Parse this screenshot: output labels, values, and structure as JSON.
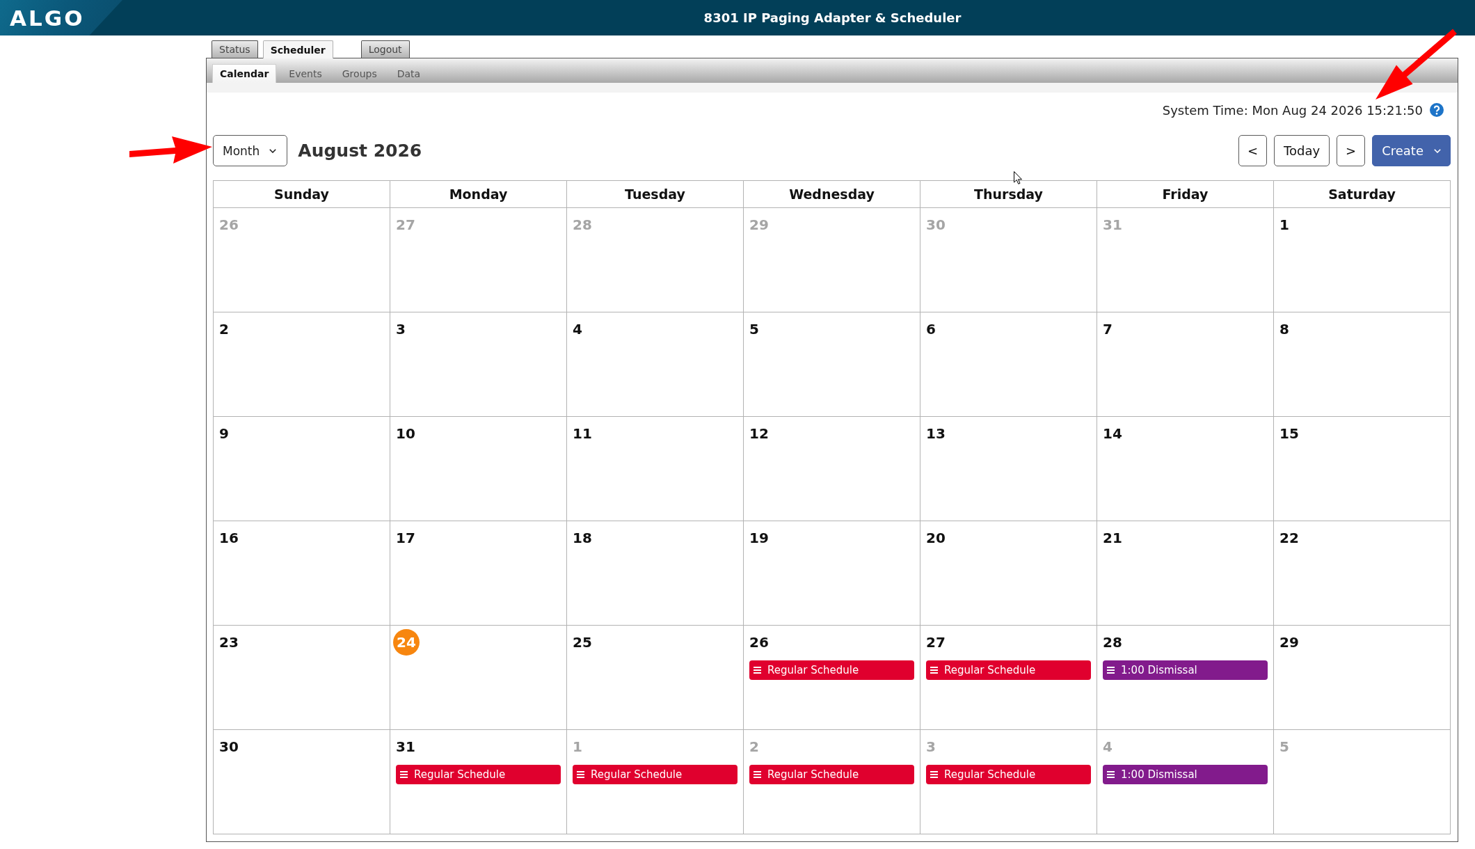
{
  "header": {
    "logo": "ALGO",
    "title": "8301 IP Paging Adapter & Scheduler"
  },
  "main_tabs": [
    {
      "label": "Status",
      "selected": false
    },
    {
      "label": "Scheduler",
      "selected": true
    }
  ],
  "logout": {
    "label": "Logout"
  },
  "sub_tabs": [
    {
      "label": "Calendar",
      "selected": true
    },
    {
      "label": "Events",
      "selected": false
    },
    {
      "label": "Groups",
      "selected": false
    },
    {
      "label": "Data",
      "selected": false
    }
  ],
  "system_time": "System Time: Mon Aug 24 2026 15:21:50",
  "toolbar": {
    "view_select": {
      "value": "Month"
    },
    "title": "August 2026",
    "buttons": [
      {
        "kind": "prev",
        "label": "<"
      },
      {
        "kind": "today",
        "label": "Today"
      },
      {
        "kind": "next",
        "label": ">"
      },
      {
        "kind": "create",
        "label": "Create"
      }
    ]
  },
  "calendar": {
    "columns": [
      "Sunday",
      "Monday",
      "Tuesday",
      "Wednesday",
      "Thursday",
      "Friday",
      "Saturday"
    ],
    "weeks": [
      {
        "days": [
          {
            "day": "26",
            "in_month": false,
            "today": false
          },
          {
            "day": "27",
            "in_month": false,
            "today": false
          },
          {
            "day": "28",
            "in_month": false,
            "today": false
          },
          {
            "day": "29",
            "in_month": false,
            "today": false
          },
          {
            "day": "30",
            "in_month": false,
            "today": false
          },
          {
            "day": "31",
            "in_month": false,
            "today": false
          },
          {
            "day": "1",
            "in_month": true,
            "today": false
          }
        ]
      },
      {
        "days": [
          {
            "day": "2",
            "in_month": true,
            "today": false
          },
          {
            "day": "3",
            "in_month": true,
            "today": false
          },
          {
            "day": "4",
            "in_month": true,
            "today": false
          },
          {
            "day": "5",
            "in_month": true,
            "today": false
          },
          {
            "day": "6",
            "in_month": true,
            "today": false
          },
          {
            "day": "7",
            "in_month": true,
            "today": false
          },
          {
            "day": "8",
            "in_month": true,
            "today": false
          }
        ]
      },
      {
        "days": [
          {
            "day": "9",
            "in_month": true,
            "today": false
          },
          {
            "day": "10",
            "in_month": true,
            "today": false
          },
          {
            "day": "11",
            "in_month": true,
            "today": false
          },
          {
            "day": "12",
            "in_month": true,
            "today": false
          },
          {
            "day": "13",
            "in_month": true,
            "today": false
          },
          {
            "day": "14",
            "in_month": true,
            "today": false
          },
          {
            "day": "15",
            "in_month": true,
            "today": false
          }
        ]
      },
      {
        "days": [
          {
            "day": "16",
            "in_month": true,
            "today": false
          },
          {
            "day": "17",
            "in_month": true,
            "today": false
          },
          {
            "day": "18",
            "in_month": true,
            "today": false
          },
          {
            "day": "19",
            "in_month": true,
            "today": false
          },
          {
            "day": "20",
            "in_month": true,
            "today": false
          },
          {
            "day": "21",
            "in_month": true,
            "today": false
          },
          {
            "day": "22",
            "in_month": true,
            "today": false
          }
        ]
      },
      {
        "days": [
          {
            "day": "23",
            "in_month": true,
            "today": false
          },
          {
            "day": "24",
            "in_month": true,
            "today": true
          },
          {
            "day": "25",
            "in_month": true,
            "today": false
          },
          {
            "day": "26",
            "in_month": true,
            "today": false,
            "events": [
              {
                "title": "Regular Schedule",
                "color": "#e0002e"
              }
            ]
          },
          {
            "day": "27",
            "in_month": true,
            "today": false,
            "events": [
              {
                "title": "Regular Schedule",
                "color": "#e0002e"
              }
            ]
          },
          {
            "day": "28",
            "in_month": true,
            "today": false,
            "events": [
              {
                "title": "1:00 Dismissal",
                "color": "#821b8c"
              }
            ]
          },
          {
            "day": "29",
            "in_month": true,
            "today": false
          }
        ]
      },
      {
        "days": [
          {
            "day": "30",
            "in_month": true,
            "today": false
          },
          {
            "day": "31",
            "in_month": true,
            "today": false,
            "events": [
              {
                "title": "Regular Schedule",
                "color": "#e0002e"
              }
            ]
          },
          {
            "day": "1",
            "in_month": false,
            "today": false,
            "events": [
              {
                "title": "Regular Schedule",
                "color": "#e0002e"
              }
            ]
          },
          {
            "day": "2",
            "in_month": false,
            "today": false,
            "events": [
              {
                "title": "Regular Schedule",
                "color": "#e0002e"
              }
            ]
          },
          {
            "day": "3",
            "in_month": false,
            "today": false,
            "events": [
              {
                "title": "Regular Schedule",
                "color": "#e0002e"
              }
            ]
          },
          {
            "day": "4",
            "in_month": false,
            "today": false,
            "events": [
              {
                "title": "1:00 Dismissal",
                "color": "#821b8c"
              }
            ]
          },
          {
            "day": "5",
            "in_month": false,
            "today": false
          }
        ]
      }
    ]
  }
}
